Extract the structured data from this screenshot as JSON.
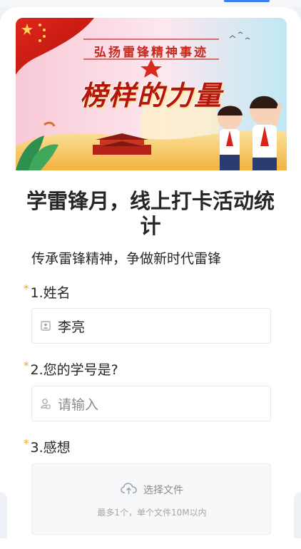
{
  "banner": {
    "subtitle": "弘扬雷锋精神事迹",
    "title": "榜样的力量"
  },
  "form": {
    "title": "学雷锋月，线上打卡活动统计",
    "description": "传承雷锋精神，争做新时代雷锋"
  },
  "questions": [
    {
      "required_mark": "*",
      "label": "1.姓名",
      "value": "李亮",
      "icon": "id-card-icon"
    },
    {
      "required_mark": "*",
      "label": "2.您的学号是?",
      "placeholder": "请输入",
      "icon": "user-badge-icon"
    },
    {
      "required_mark": "*",
      "label": "3.感想",
      "upload_label": "选择文件",
      "upload_hint": "最多1个，单个文件10M以内",
      "icon": "cloud-upload-icon"
    }
  ],
  "colors": {
    "required": "#f5a623",
    "accent": "#3f7df2",
    "banner_red": "#c8291e"
  }
}
